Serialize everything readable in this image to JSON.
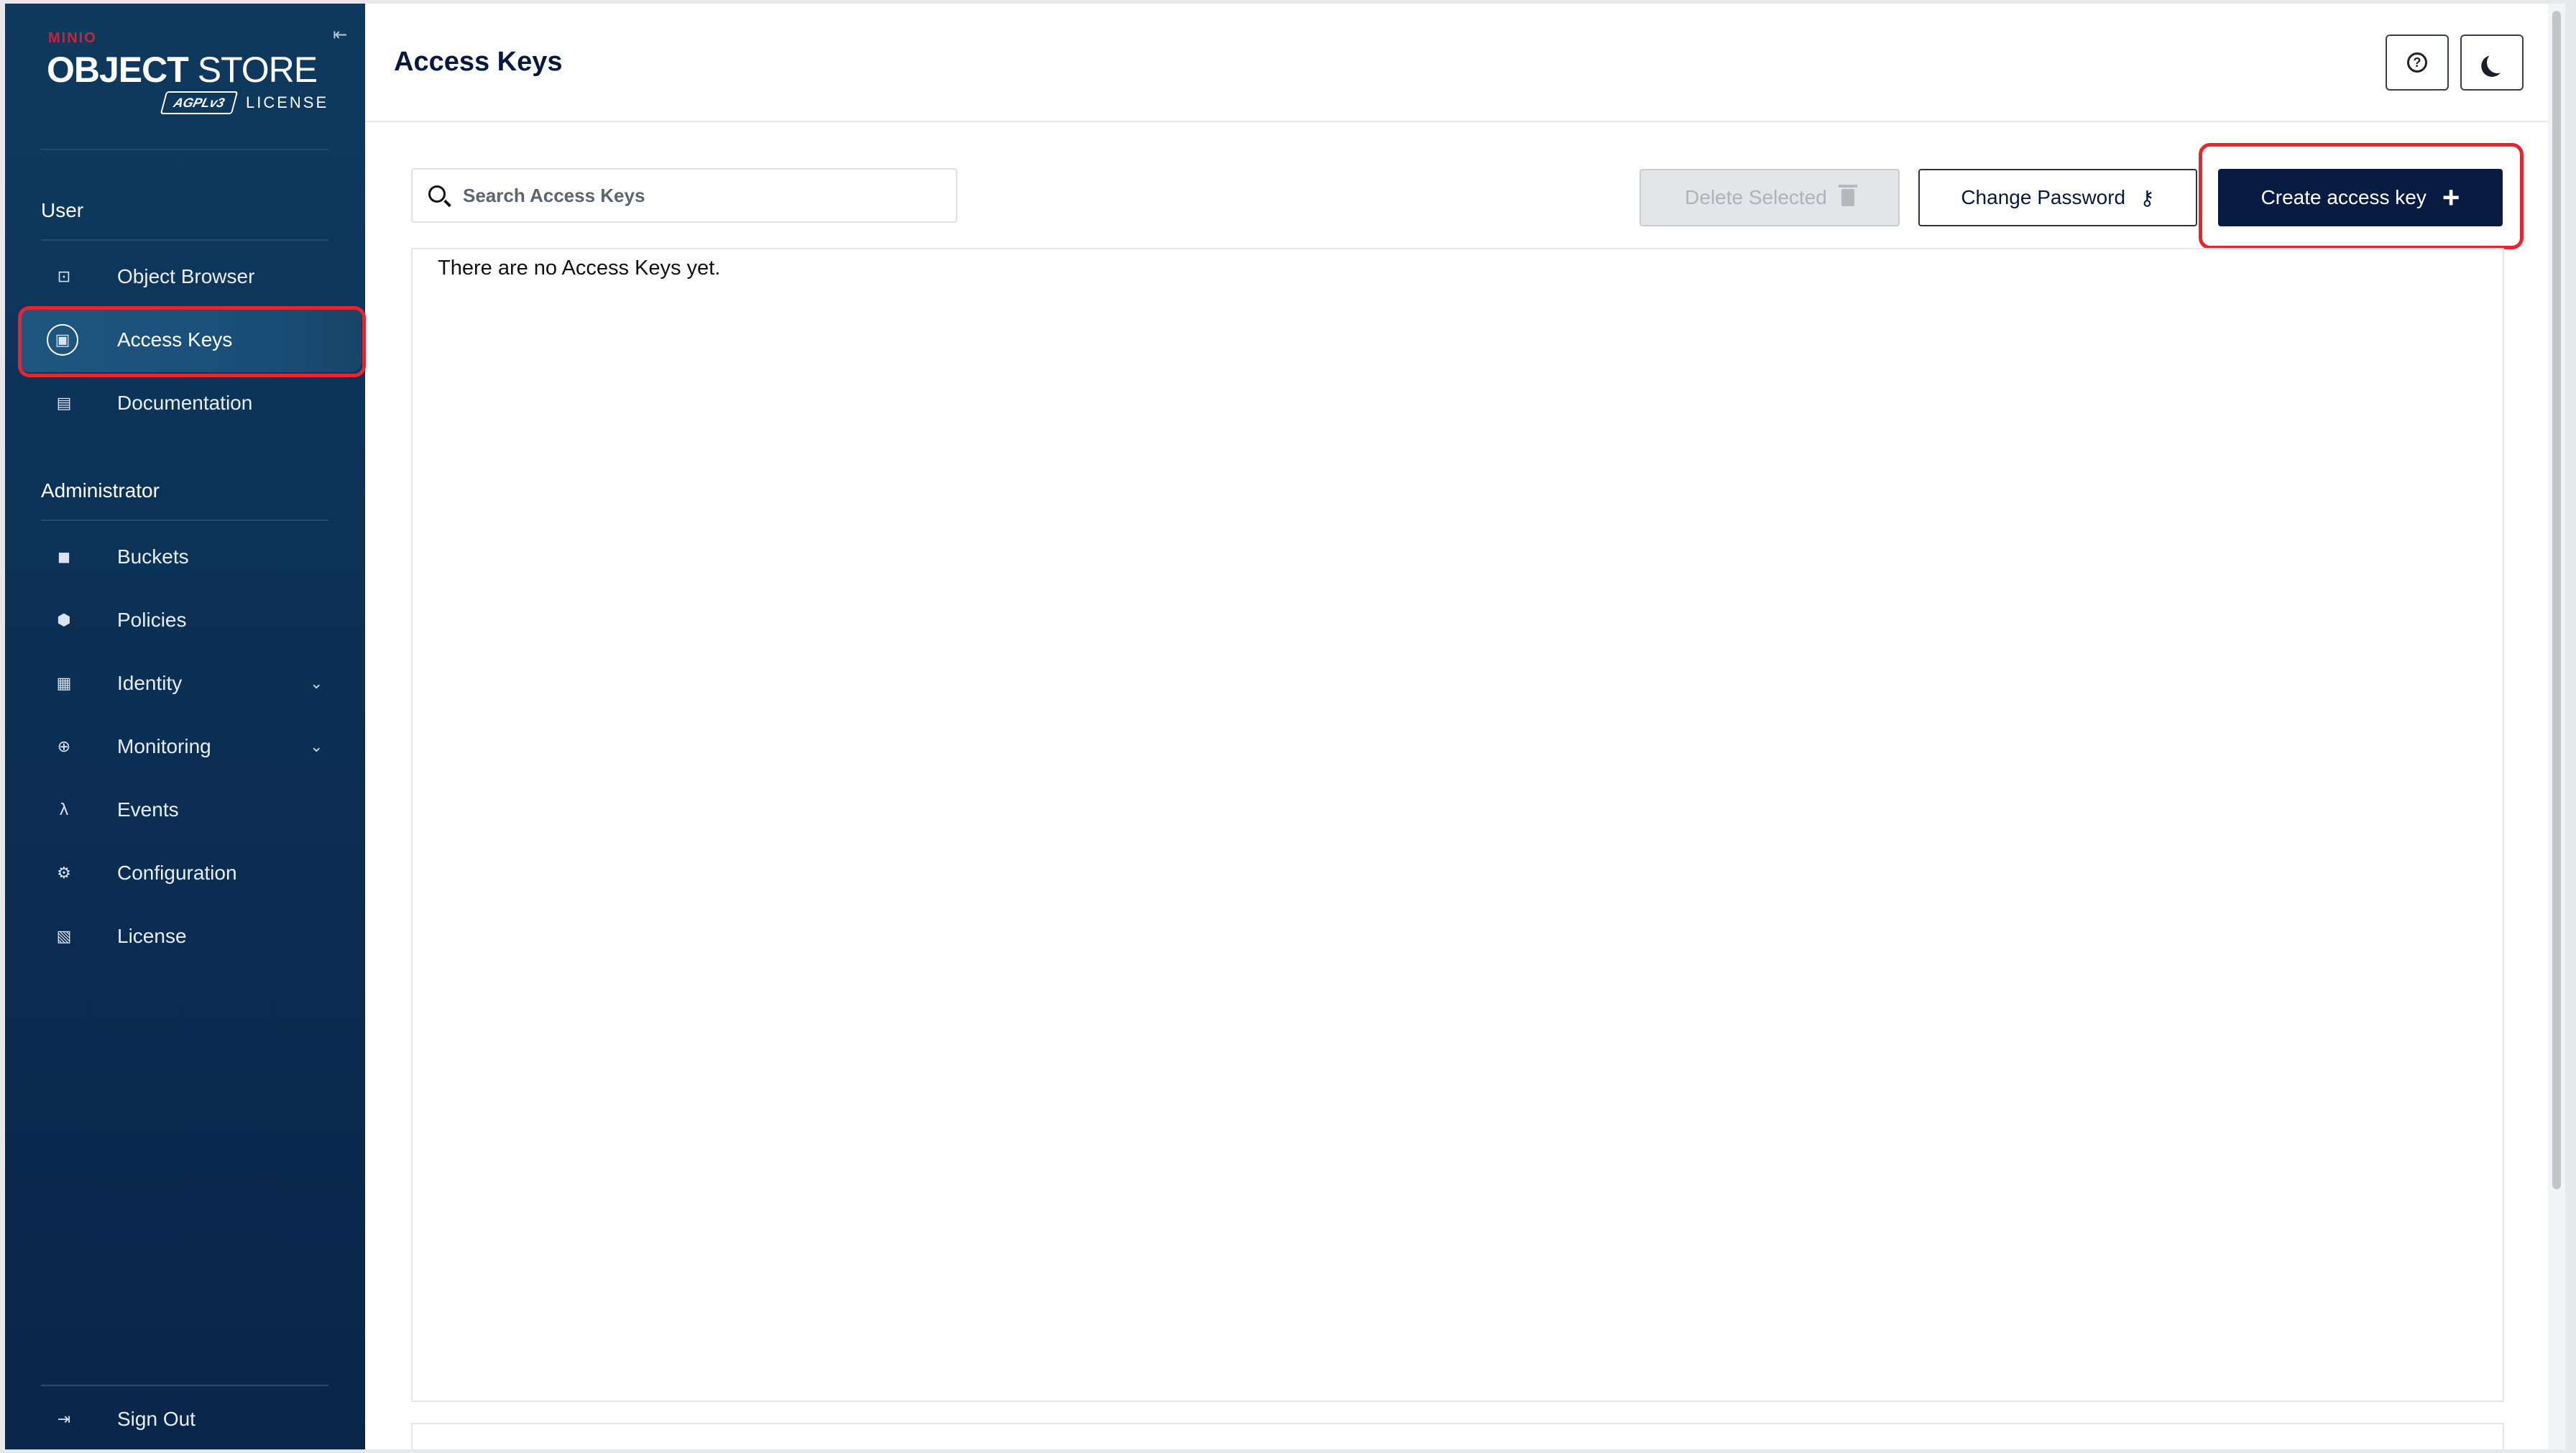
{
  "brand": {
    "company": "MINIO",
    "product_bold": "OBJECT",
    "product_light": "STORE",
    "badge": "AGPLv3",
    "license_label": "LICENSE"
  },
  "sidebar": {
    "collapse_icon": "collapse-sidebar-icon",
    "user_section_title": "User",
    "user_items": [
      {
        "label": "Object Browser",
        "icon": "object-browser-icon"
      },
      {
        "label": "Access Keys",
        "icon": "access-keys-icon"
      },
      {
        "label": "Documentation",
        "icon": "documentation-icon"
      }
    ],
    "admin_section_title": "Administrator",
    "admin_items": [
      {
        "label": "Buckets",
        "icon": "buckets-icon"
      },
      {
        "label": "Policies",
        "icon": "policies-icon"
      },
      {
        "label": "Identity",
        "icon": "identity-icon"
      },
      {
        "label": "Monitoring",
        "icon": "monitoring-icon"
      },
      {
        "label": "Events",
        "icon": "lambda-icon"
      },
      {
        "label": "Configuration",
        "icon": "gear-icon"
      },
      {
        "label": "License",
        "icon": "license-icon"
      }
    ],
    "sign_out_label": "Sign Out"
  },
  "header": {
    "title": "Access Keys",
    "help_icon": "help-icon",
    "theme_icon": "moon-icon"
  },
  "toolbar": {
    "search_placeholder": "Search Access Keys",
    "search_value": "",
    "delete_label": "Delete Selected",
    "change_password_label": "Change Password",
    "create_label": "Create access key",
    "create_icon": "+"
  },
  "content": {
    "empty_message": "There are no Access Keys yet."
  },
  "colors": {
    "sidebar_bg": "#0b2e52",
    "primary_button": "#081c42",
    "highlight": "#e8242f",
    "brand_red": "#c8243b"
  }
}
